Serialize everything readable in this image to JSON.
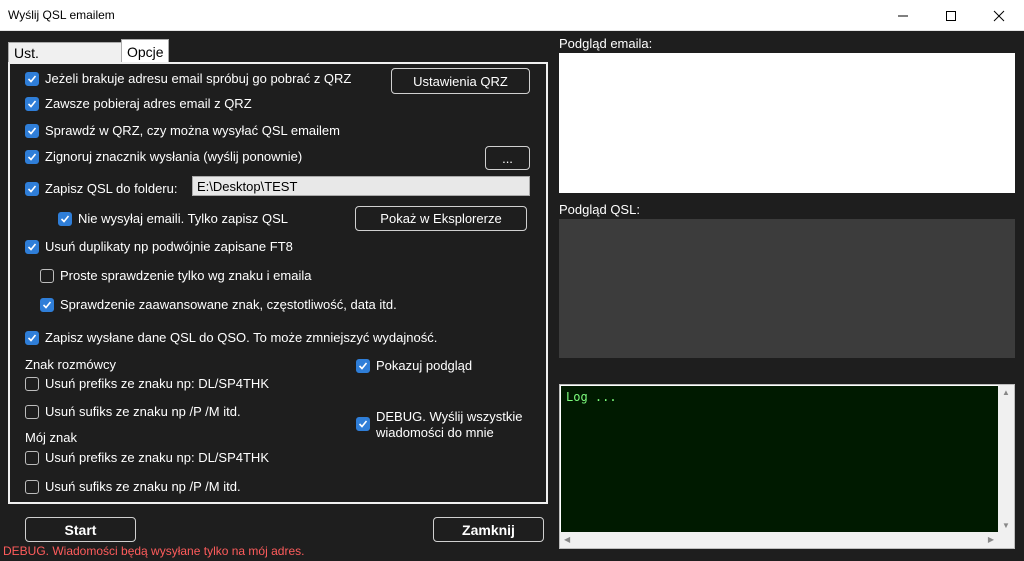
{
  "window": {
    "title": "Wyślij QSL emailem"
  },
  "tabs": [
    {
      "label": "Ust. podstawowe",
      "active": false
    },
    {
      "label": "Opcje",
      "active": true
    }
  ],
  "options": {
    "fetch_missing_email": {
      "label": "Jeżeli brakuje adresu email spróbuj go pobrać z QRZ",
      "checked": true
    },
    "always_fetch_email": {
      "label": "Zawsze pobieraj adres email z QRZ",
      "checked": true
    },
    "check_qrz_allows": {
      "label": "Sprawdź w QRZ, czy można wysyłać QSL emailem",
      "checked": true
    },
    "ignore_sent_flag": {
      "label": "Zignoruj znacznik wysłania (wyślij ponownie)",
      "checked": true
    },
    "save_to_folder": {
      "label": "Zapisz QSL do folderu:",
      "checked": true
    },
    "folder_path": "E:\\Desktop\\TEST",
    "no_send_only_save": {
      "label": "Nie wysyłaj emaili. Tylko zapisz QSL",
      "checked": true
    },
    "remove_duplicates": {
      "label": "Usuń duplikaty np podwójnie zapisane FT8",
      "checked": true
    },
    "simple_check": {
      "label": "Proste sprawdzenie tylko wg znaku i emaila",
      "checked": false
    },
    "advanced_check": {
      "label": "Sprawdzenie zaawansowane znak, częstotliwość, data itd.",
      "checked": true
    },
    "save_sent_to_qso": {
      "label": "Zapisz wysłane dane QSL do QSO. To może zmniejszyć wydajność.",
      "checked": true
    },
    "callsign_section": "Znak rozmówcy",
    "remove_prefix_other": {
      "label": "Usuń prefiks ze znaku np: DL/SP4THK",
      "checked": false
    },
    "remove_suffix_other": {
      "label": "Usuń sufiks ze znaku np /P /M itd.",
      "checked": false
    },
    "my_call_section": "Mój znak",
    "remove_prefix_my": {
      "label": "Usuń prefiks ze znaku np: DL/SP4THK",
      "checked": false
    },
    "remove_suffix_my": {
      "label": "Usuń sufiks ze znaku np /P /M itd.",
      "checked": false
    },
    "show_preview": {
      "label": "Pokazuj podgląd",
      "checked": true
    },
    "debug_send_to_me": {
      "label_line1": "DEBUG. Wyślij wszystkie",
      "label_line2": "wiadomości do mnie",
      "checked": true
    }
  },
  "buttons": {
    "qrz_settings": "Ustawienia QRZ",
    "more": "...",
    "show_in_explorer": "Pokaż w Eksplorerze",
    "start": "Start",
    "close": "Zamknij"
  },
  "right_panel": {
    "email_preview_label": "Podgląd emaila:",
    "qsl_preview_label": "Podgląd QSL:",
    "log_text": "Log ..."
  },
  "status": {
    "debug_note": "DEBUG. Wiadomości będą wysyłane tylko na mój adres."
  },
  "colors": {
    "accent_check": "#2f7ed8",
    "debug_text": "#ff5c5c",
    "log_text": "#7cfc7c",
    "log_bg": "#001a00"
  }
}
